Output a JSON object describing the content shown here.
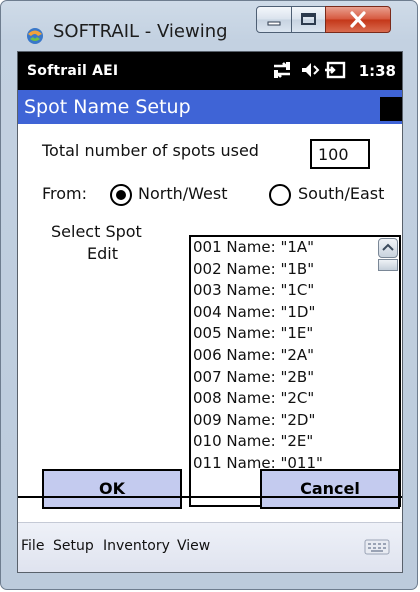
{
  "window": {
    "title": "SOFTRAIL - Viewing"
  },
  "statusbar": {
    "app_name": "Softrail AEI",
    "time": "1:38"
  },
  "header": {
    "title": "Spot Name Setup"
  },
  "form": {
    "total_label": "Total number of spots used",
    "total_value": "100",
    "from_label": "From:",
    "radio_options": [
      {
        "label": "North/West",
        "selected": true
      },
      {
        "label": "South/East",
        "selected": false
      }
    ],
    "select_label_1": "Select Spot",
    "select_label_2": "Edit"
  },
  "spot_list": [
    "001 Name: \"1A\"",
    "002 Name: \"1B\"",
    "003 Name: \"1C\"",
    "004 Name: \"1D\"",
    "005 Name: \"1E\"",
    "006 Name: \"2A\"",
    "007 Name: \"2B\"",
    "008 Name: \"2C\"",
    "009 Name: \"2D\"",
    "010 Name: \"2E\"",
    "011 Name: \"011\""
  ],
  "buttons": {
    "ok": "OK",
    "cancel": "Cancel"
  },
  "menu": {
    "items": [
      "File",
      "Setup",
      "Inventory",
      "View"
    ]
  },
  "colors": {
    "header_bg": "#3f64d6",
    "button_bg": "#c4cbef",
    "statusbar_bg": "#000000"
  }
}
